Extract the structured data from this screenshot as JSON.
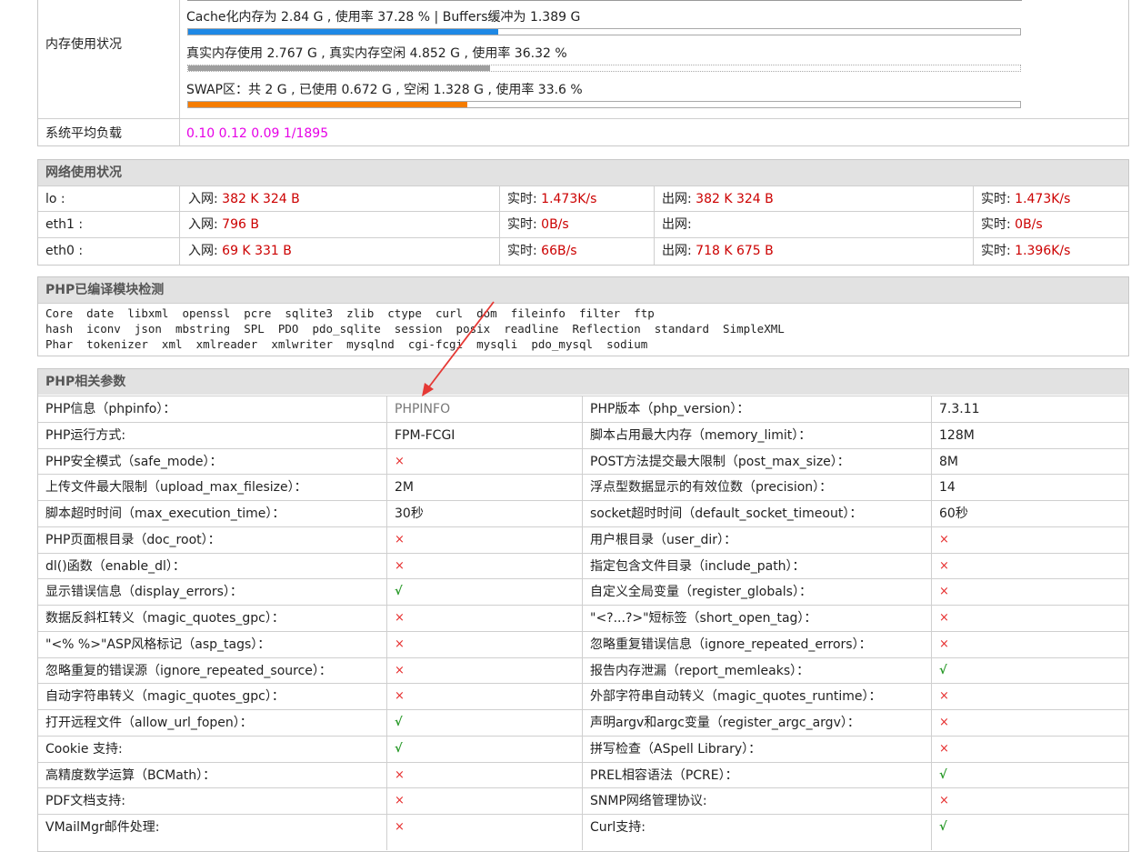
{
  "memory": {
    "label": "内存使用状况",
    "cache_line": "Cache化内存为 2.84 G , 使用率 37.28 % | Buffers缓冲为 1.389 G",
    "cache_pct": 0.3728,
    "real_line": "真实内存使用 2.767 G , 真实内存空闲 4.852 G , 使用率 36.32 %",
    "real_pct": 0.3632,
    "swap_line": "SWAP区：共 2 G , 已使用 0.672 G , 空闲 1.328 G , 使用率 33.6 %",
    "swap_pct": 0.336,
    "load_label": "系统平均负载",
    "load_value": "0.10 0.12 0.09 1/1895"
  },
  "colors": {
    "cache_bar": "#1e88e5",
    "real_bar": "#9e9e9e",
    "swap_bar": "#f57c00"
  },
  "network": {
    "title": "网络使用状况",
    "in_label": "入网:",
    "out_label": "出网:",
    "rt_label": "实时:",
    "rows": [
      {
        "iface": "lo :",
        "in": "382 K 324 B",
        "in_rt": "1.473K/s",
        "out": "382 K 324 B",
        "out_rt": "1.473K/s"
      },
      {
        "iface": "eth1 :",
        "in": "796 B",
        "in_rt": "0B/s",
        "out": "",
        "out_rt": "0B/s"
      },
      {
        "iface": "eth0 :",
        "in": "69 K 331 B",
        "in_rt": "66B/s",
        "out": "718 K 675 B",
        "out_rt": "1.396K/s"
      }
    ]
  },
  "modules": {
    "title": "PHP已编译模块检测",
    "line1": "Core  date  libxml  openssl  pcre  sqlite3  zlib  ctype  curl  dom  fileinfo  filter  ftp",
    "line2": "hash  iconv  json  mbstring  SPL  PDO  pdo_sqlite  session  posix  readline  Reflection  standard  SimpleXML",
    "line3": "Phar  tokenizer  xml  xmlreader  xmlwriter  mysqlnd  cgi-fcgi  mysqli  pdo_mysql  sodium"
  },
  "php": {
    "title": "PHP相关参数",
    "rows": [
      {
        "l1": "PHP信息（phpinfo）：",
        "v1": "PHPINFO",
        "l2": "PHP版本（php_version）：",
        "v2": "7.3.11"
      },
      {
        "l1": "PHP运行方式:",
        "v1": "FPM-FCGI",
        "l2": "脚本占用最大内存（memory_limit）：",
        "v2": "128M"
      },
      {
        "l1": "PHP安全模式（safe_mode）：",
        "v1": "×",
        "l2": "POST方法提交最大限制（post_max_size）：",
        "v2": "8M"
      },
      {
        "l1": "上传文件最大限制（upload_max_filesize）：",
        "v1": "2M",
        "l2": "浮点型数据显示的有效位数（precision）：",
        "v2": "14"
      },
      {
        "l1": "脚本超时时间（max_execution_time）：",
        "v1": "30秒",
        "l2": "socket超时时间（default_socket_timeout）：",
        "v2": "60秒"
      },
      {
        "l1": "PHP页面根目录（doc_root）：",
        "v1": "×",
        "l2": "用户根目录（user_dir）：",
        "v2": "×"
      },
      {
        "l1": "dl()函数（enable_dl）：",
        "v1": "×",
        "l2": "指定包含文件目录（include_path）：",
        "v2": "×"
      },
      {
        "l1": "显示错误信息（display_errors）：",
        "v1": "√",
        "l2": "自定义全局变量（register_globals）：",
        "v2": "×"
      },
      {
        "l1": "数据反斜杠转义（magic_quotes_gpc）：",
        "v1": "×",
        "l2": "\"<?...?>\"短标签（short_open_tag）：",
        "v2": "×"
      },
      {
        "l1": "\"<% %>\"ASP风格标记（asp_tags）：",
        "v1": "×",
        "l2": "忽略重复错误信息（ignore_repeated_errors）：",
        "v2": "×"
      },
      {
        "l1": "忽略重复的错误源（ignore_repeated_source）：",
        "v1": "×",
        "l2": "报告内存泄漏（report_memleaks）：",
        "v2": "√"
      },
      {
        "l1": "自动字符串转义（magic_quotes_gpc）：",
        "v1": "×",
        "l2": "外部字符串自动转义（magic_quotes_runtime）：",
        "v2": "×"
      },
      {
        "l1": "打开远程文件（allow_url_fopen）：",
        "v1": "√",
        "l2": "声明argv和argc变量（register_argc_argv）：",
        "v2": "×"
      },
      {
        "l1": "Cookie 支持:",
        "v1": "√",
        "l2": "拼写检查（ASpell Library）：",
        "v2": "×"
      },
      {
        "l1": "高精度数学运算（BCMath）：",
        "v1": "×",
        "l2": "PREL相容语法（PCRE）：",
        "v2": "√"
      },
      {
        "l1": "PDF文档支持:",
        "v1": "×",
        "l2": "SNMP网络管理协议:",
        "v2": "×"
      },
      {
        "l1": "VMailMgr邮件处理:",
        "v1": "×",
        "l2": "Curl支持:",
        "v2": "√"
      }
    ]
  }
}
